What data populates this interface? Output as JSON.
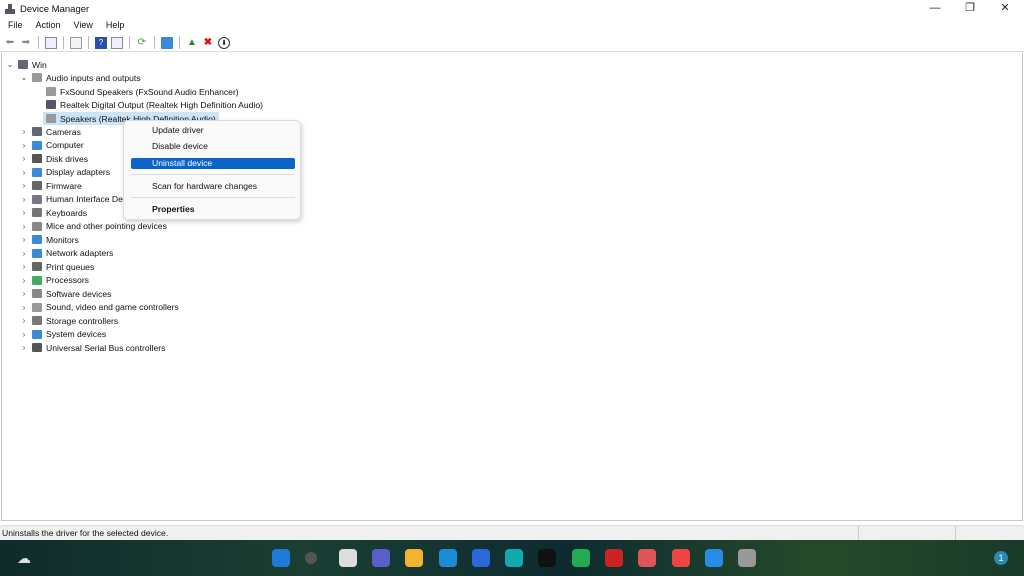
{
  "window": {
    "title": "Device Manager",
    "minimize": "—",
    "maximize": "❐",
    "close": "✕"
  },
  "menu": [
    "File",
    "Action",
    "View",
    "Help"
  ],
  "tree": {
    "root": "Win",
    "audio": {
      "label": "Audio inputs and outputs",
      "children": [
        "FxSound Speakers (FxSound Audio Enhancer)",
        "Realtek Digital Output (Realtek High Definition Audio)",
        "Speakers (Realtek High Definition Audio)"
      ]
    },
    "categories": [
      "Cameras",
      "Computer",
      "Disk drives",
      "Display adapters",
      "Firmware",
      "Human Interface Devices",
      "Keyboards",
      "Mice and other pointing devices",
      "Monitors",
      "Network adapters",
      "Print queues",
      "Processors",
      "Software devices",
      "Sound, video and game controllers",
      "Storage controllers",
      "System devices",
      "Universal Serial Bus controllers"
    ]
  },
  "context_menu": {
    "update": "Update driver",
    "disable": "Disable device",
    "uninstall": "Uninstall device",
    "scan": "Scan for hardware changes",
    "properties": "Properties"
  },
  "status": "Uninstalls the driver for the selected device.",
  "taskbar": {
    "notification_count": "1",
    "apps": [
      "widgets",
      "search",
      "task-view",
      "teams",
      "file-explorer",
      "edge",
      "store",
      "ccleaner",
      "tiktok",
      "app",
      "antivirus",
      "office",
      "chrome",
      "zalo",
      "device-manager"
    ]
  },
  "colors": {
    "accent": "#0a64c8",
    "selection": "#cce4f7"
  }
}
